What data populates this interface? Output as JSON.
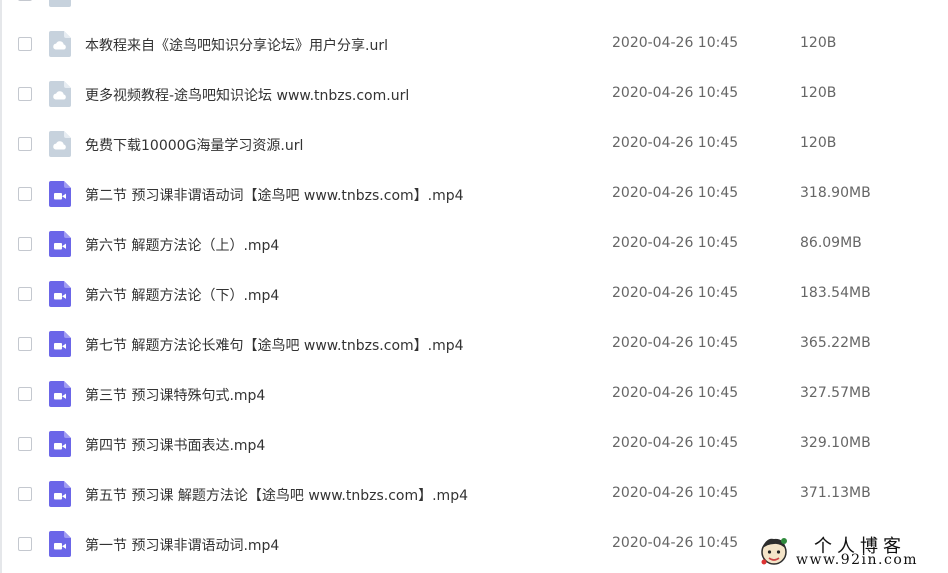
{
  "colors": {
    "url_icon": "#c7d2dd",
    "video_icon": "#6b66e8",
    "name_text": "#333333",
    "meta_text": "#666666"
  },
  "files": [
    {
      "name": "本教程来自《途鸟吧知识分享论坛》用户分享.url",
      "date": "2020-04-26 10:45",
      "size": "120B",
      "icon": "url-file-icon"
    },
    {
      "name": "更多视频教程-途鸟吧知识论坛 www.tnbzs.com.url",
      "date": "2020-04-26 10:45",
      "size": "120B",
      "icon": "url-file-icon"
    },
    {
      "name": "免费下载10000G海量学习资源.url",
      "date": "2020-04-26 10:45",
      "size": "120B",
      "icon": "url-file-icon"
    },
    {
      "name": "第二节 预习课非谓语动词【途鸟吧 www.tnbzs.com】.mp4",
      "date": "2020-04-26 10:45",
      "size": "318.90MB",
      "icon": "video-file-icon"
    },
    {
      "name": "第六节 解题方法论（上）.mp4",
      "date": "2020-04-26 10:45",
      "size": "86.09MB",
      "icon": "video-file-icon"
    },
    {
      "name": "第六节 解题方法论（下）.mp4",
      "date": "2020-04-26 10:45",
      "size": "183.54MB",
      "icon": "video-file-icon"
    },
    {
      "name": "第七节 解题方法论长难句【途鸟吧 www.tnbzs.com】.mp4",
      "date": "2020-04-26 10:45",
      "size": "365.22MB",
      "icon": "video-file-icon"
    },
    {
      "name": "第三节 预习课特殊句式.mp4",
      "date": "2020-04-26 10:45",
      "size": "327.57MB",
      "icon": "video-file-icon"
    },
    {
      "name": "第四节 预习课书面表达.mp4",
      "date": "2020-04-26 10:45",
      "size": "329.10MB",
      "icon": "video-file-icon"
    },
    {
      "name": "第五节 预习课 解题方法论【途鸟吧 www.tnbzs.com】.mp4",
      "date": "2020-04-26 10:45",
      "size": "371.13MB",
      "icon": "video-file-icon"
    },
    {
      "name": "第一节 预习课非谓语动词.mp4",
      "date": "2020-04-26 10:45",
      "size": "",
      "icon": "video-file-icon"
    }
  ],
  "watermark": {
    "title": "个人博客",
    "url": "www.92in.com"
  }
}
